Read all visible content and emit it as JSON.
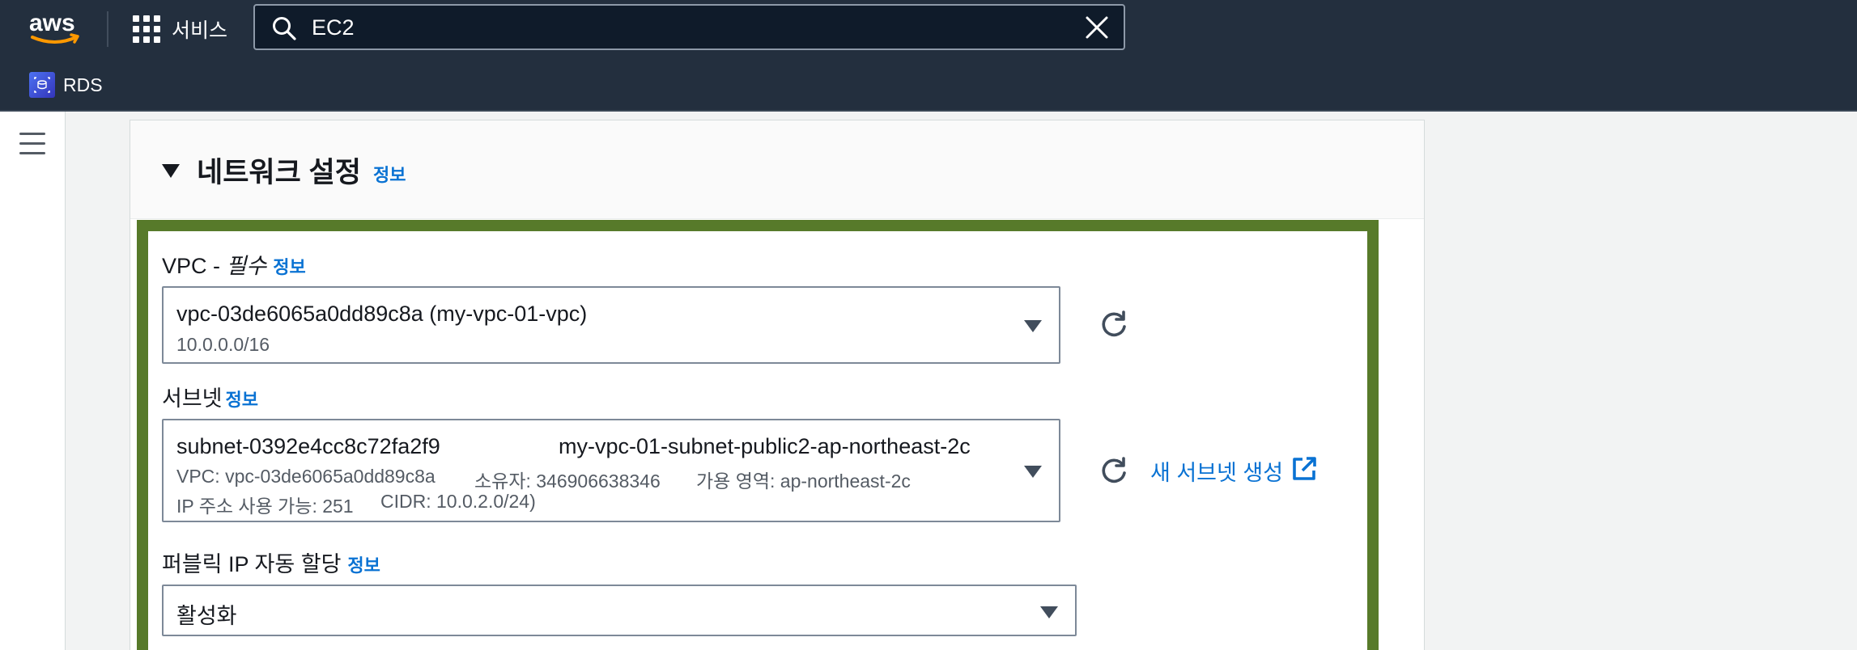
{
  "topnav": {
    "logo_text": "aws",
    "services_label": "서비스",
    "search_value": "EC2",
    "favorites": [
      {
        "label": "RDS",
        "icon": "rds-icon"
      }
    ]
  },
  "section": {
    "title": "네트워크 설정",
    "info_label": "정보"
  },
  "vpc": {
    "label": "VPC - ",
    "required": "필수",
    "info": "정보",
    "value": "vpc-03de6065a0dd89c8a (my-vpc-01-vpc)",
    "cidr": "10.0.0.0/16"
  },
  "subnet": {
    "label": "서브넷",
    "info": "정보",
    "id": "subnet-0392e4cc8c72fa2f9",
    "name": "my-vpc-01-subnet-public2-ap-northeast-2c",
    "vpc_text": "VPC: vpc-03de6065a0dd89c8a",
    "owner_text": "소유자: 346906638346",
    "az_text": "가용 영역: ap-northeast-2c",
    "ip_text": "IP 주소 사용 가능: 251",
    "cidr_text": "CIDR: 10.0.2.0/24)",
    "create_link": "새 서브넷 생성"
  },
  "public_ip": {
    "label": "퍼블릭 IP 자동 할당",
    "info": "정보",
    "value": "활성화"
  },
  "colors": {
    "nav_bg": "#232f3e",
    "link": "#0972d3",
    "highlight": "#577a2a",
    "aws_orange": "#ff9900"
  }
}
